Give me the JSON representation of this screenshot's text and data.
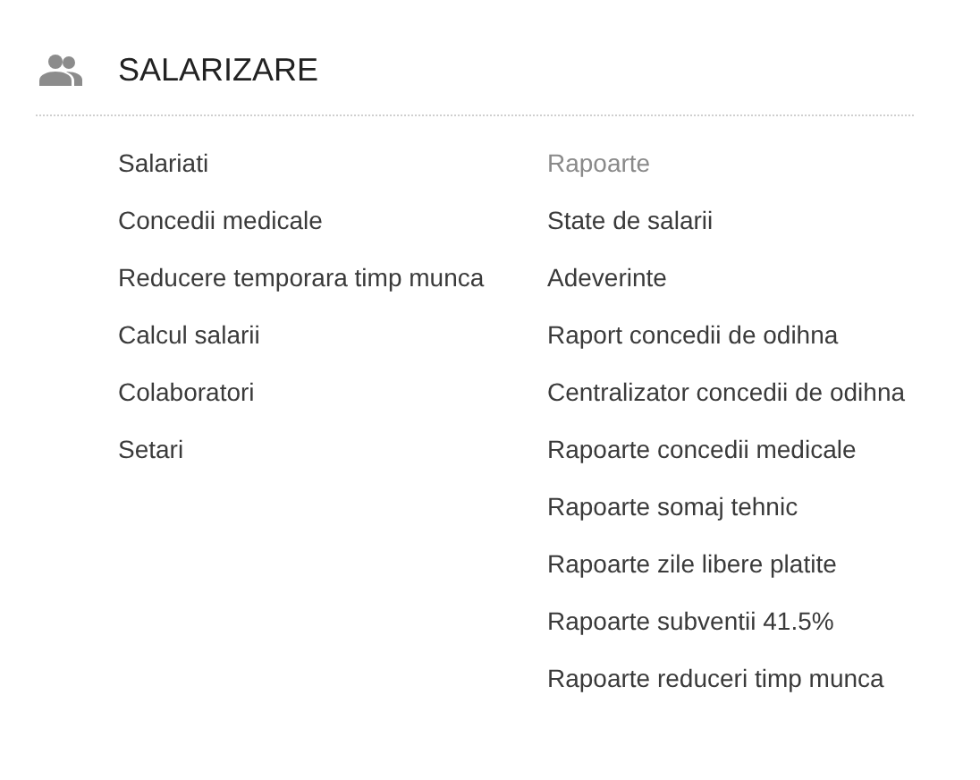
{
  "section": {
    "title": "SALARIZARE"
  },
  "columns": [
    [
      {
        "kind": "link",
        "label": "Salariati"
      },
      {
        "kind": "link",
        "label": "Concedii medicale"
      },
      {
        "kind": "link",
        "label": "Reducere temporara timp munca"
      },
      {
        "kind": "link",
        "label": "Calcul salarii"
      },
      {
        "kind": "link",
        "label": "Colaboratori"
      },
      {
        "kind": "link",
        "label": "Setari"
      }
    ],
    [
      {
        "kind": "heading",
        "label": "Rapoarte"
      },
      {
        "kind": "link",
        "label": "State de salarii"
      },
      {
        "kind": "link",
        "label": "Adeverinte"
      },
      {
        "kind": "link",
        "label": "Raport concedii de odihna"
      },
      {
        "kind": "link",
        "label": "Centralizator concedii de odihna"
      },
      {
        "kind": "link",
        "label": "Rapoarte concedii medicale"
      },
      {
        "kind": "link",
        "label": "Rapoarte somaj tehnic"
      },
      {
        "kind": "link",
        "label": "Rapoarte zile libere platite"
      },
      {
        "kind": "link",
        "label": "Rapoarte subventii 41.5%"
      },
      {
        "kind": "link",
        "label": "Rapoarte reduceri timp munca"
      }
    ]
  ]
}
